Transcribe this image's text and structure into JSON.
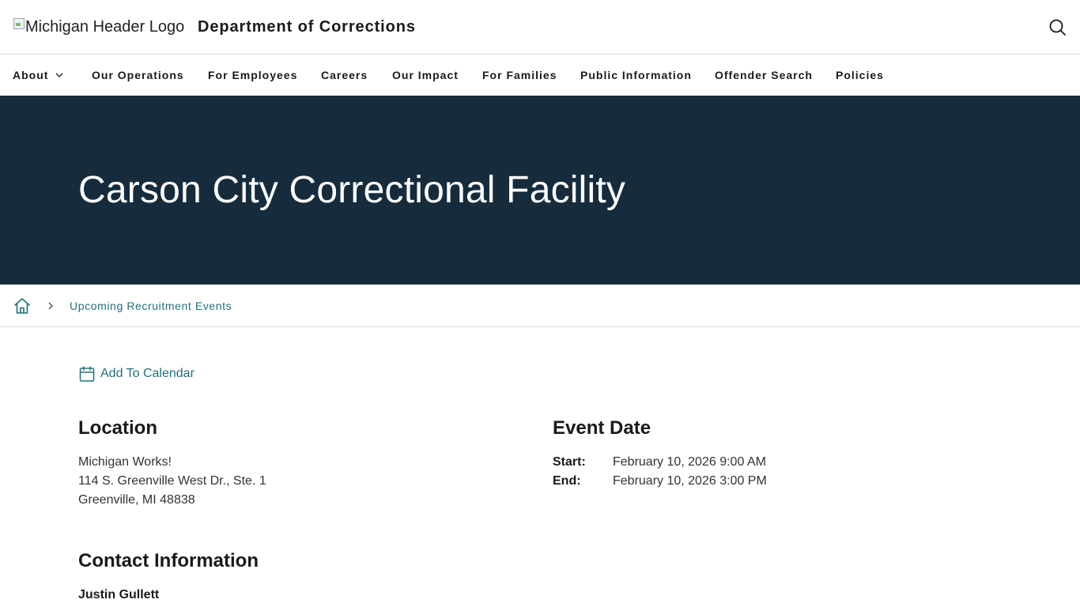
{
  "header": {
    "logo_alt": "Michigan Header Logo",
    "title": "Department of Corrections",
    "search_icon": "search-icon"
  },
  "nav": {
    "items": [
      {
        "label": "About",
        "has_dropdown": true
      },
      {
        "label": "Our Operations"
      },
      {
        "label": "For Employees"
      },
      {
        "label": "Careers"
      },
      {
        "label": "Our Impact"
      },
      {
        "label": "For Families"
      },
      {
        "label": "Public Information"
      },
      {
        "label": "Offender Search"
      },
      {
        "label": "Policies"
      }
    ]
  },
  "hero": {
    "title": "Carson City Correctional Facility"
  },
  "breadcrumb": {
    "home_icon": "home-icon",
    "current": "Upcoming Recruitment Events"
  },
  "actions": {
    "add_to_calendar": "Add To Calendar"
  },
  "location": {
    "heading": "Location",
    "line1": "Michigan Works!",
    "line2": "114 S. Greenville West Dr., Ste. 1",
    "line3": "Greenville, MI 48838"
  },
  "event_date": {
    "heading": "Event Date",
    "start_label": "Start:",
    "start_value": "February 10, 2026 9:00 AM",
    "end_label": "End:",
    "end_value": "February 10, 2026 3:00 PM"
  },
  "contact": {
    "heading": "Contact Information",
    "name": "Justin Gullett"
  },
  "colors": {
    "hero_bg": "#162c3d",
    "link": "#21707d",
    "text": "#1a1a1a"
  }
}
